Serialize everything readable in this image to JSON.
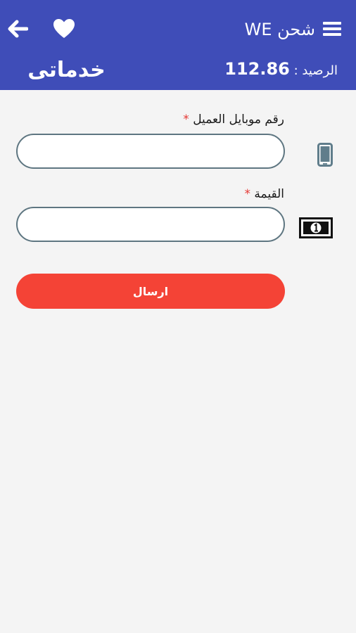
{
  "header": {
    "title": "شحن WE",
    "logo_text": "خدماتى",
    "balance_label": "الرصيد :",
    "balance_value": "112.86",
    "icons": {
      "back": "arrow-left-icon",
      "favorite": "heart-icon",
      "menu": "hamburger-menu-icon"
    }
  },
  "form": {
    "mobile_label": "رقم موبايل العميل",
    "mobile_value": "",
    "amount_label": "القيمة",
    "amount_value": "",
    "required_mark": "*",
    "submit_label": "ارسال"
  },
  "colors": {
    "header_bg": "#3f4db8",
    "submit_bg": "#f44336",
    "field_border": "#5e7681",
    "required": "#e53935",
    "page_bg": "#f4f4f4"
  }
}
